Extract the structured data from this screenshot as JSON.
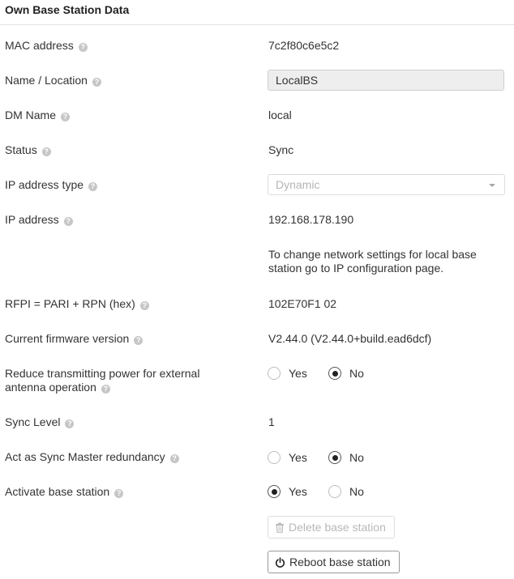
{
  "section": {
    "title": "Own Base Station Data"
  },
  "fields": {
    "mac": {
      "label": "MAC address",
      "value": "7c2f80c6e5c2"
    },
    "name": {
      "label": "Name / Location",
      "value": "LocalBS"
    },
    "dm": {
      "label": "DM Name",
      "value": "local"
    },
    "status": {
      "label": "Status",
      "value": "Sync"
    },
    "ip_type": {
      "label": "IP address type",
      "value": "Dynamic"
    },
    "ip": {
      "label": "IP address",
      "value": "192.168.178.190"
    },
    "ip_note": {
      "line1": "To change network settings for local base",
      "line2": "station go to IP configuration page."
    },
    "rfpi": {
      "label": "RFPI = PARI + RPN (hex)",
      "value": "102E70F1 02"
    },
    "firmware": {
      "label": "Current firmware version",
      "value": "V2.44.0 (V2.44.0+build.ead6dcf)"
    },
    "reduce_power": {
      "label_line1": "Reduce transmitting power for external",
      "label_line2": "antenna operation",
      "yes": "Yes",
      "no": "No",
      "selected": "No"
    },
    "sync_level": {
      "label": "Sync Level",
      "value": "1"
    },
    "sync_master": {
      "label": "Act as Sync Master redundancy",
      "yes": "Yes",
      "no": "No",
      "selected": "No"
    },
    "activate": {
      "label": "Activate base station",
      "yes": "Yes",
      "no": "No",
      "selected": "Yes"
    }
  },
  "buttons": {
    "delete": "Delete base station",
    "reboot": "Reboot base station"
  },
  "help_glyph": "?",
  "icons": {
    "help": "question-circle-icon",
    "delete": "trash-icon",
    "reboot": "power-icon"
  },
  "colors": {
    "help_icon": "#c6c6c6",
    "input_bg": "#eeeeee",
    "disabled_text": "#b8b8b8"
  }
}
